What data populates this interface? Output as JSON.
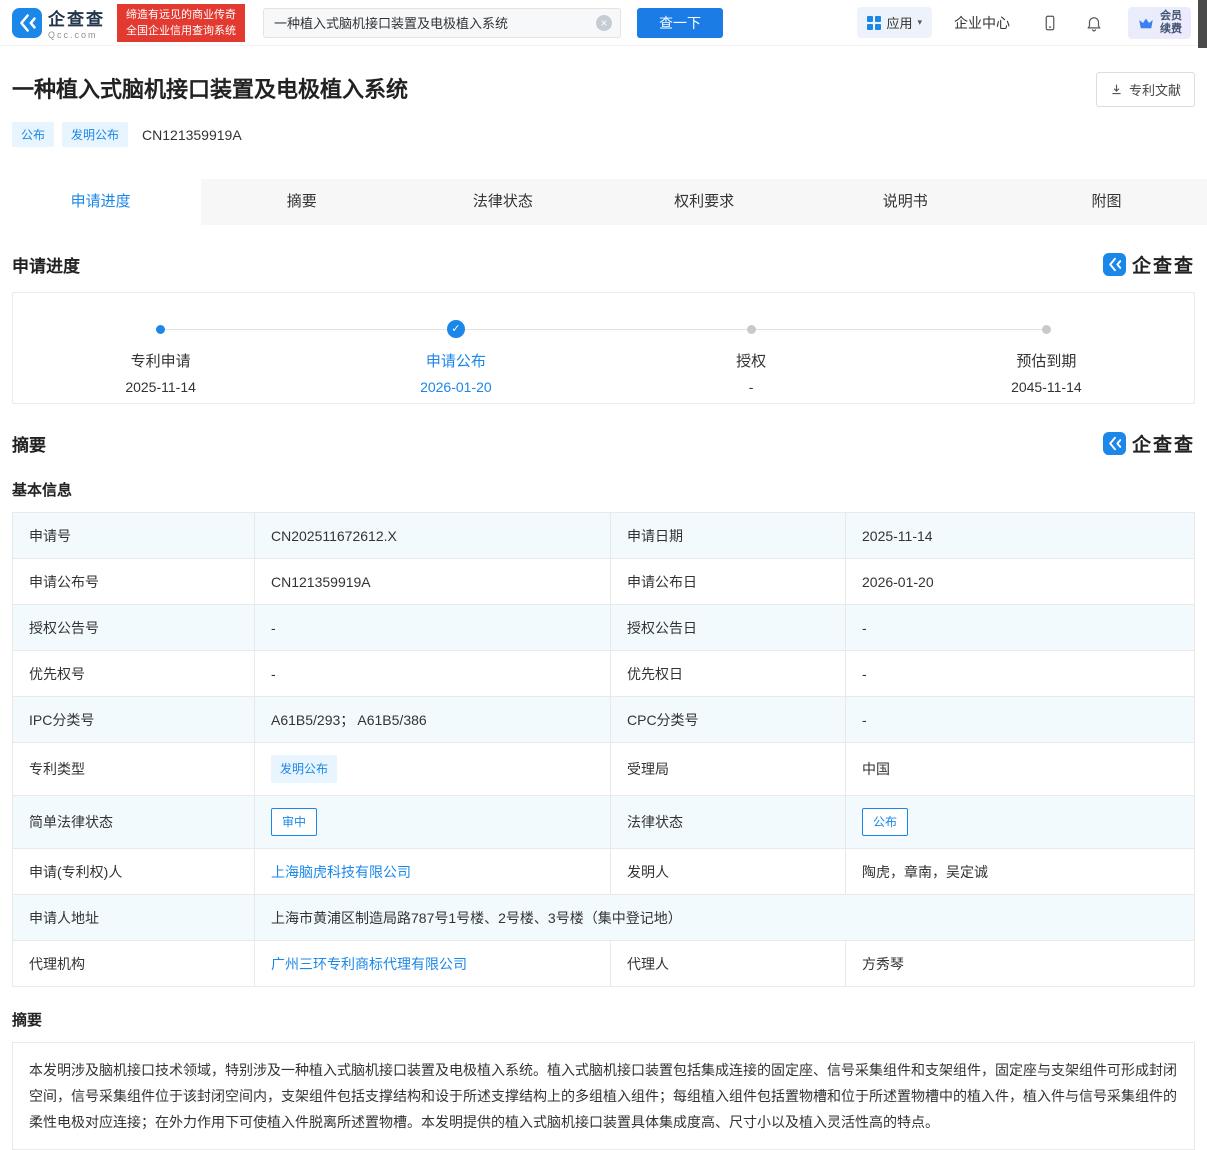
{
  "colors": {
    "brand_blue": "#1b87e8",
    "banner_red": "#e23a30",
    "row_alt": "#f3fafe",
    "tag_bg": "#e8f4fe"
  },
  "icons": {
    "check": "✓",
    "close": "×",
    "caret": "▾"
  },
  "watermark": "企查查",
  "header": {
    "logo": {
      "brand": "企查查",
      "domain": "Qcc.com"
    },
    "slogan": {
      "line1": "缔造有远见的商业传奇",
      "line2": "全国企业信用查询系统"
    },
    "search": {
      "value": "一种植入式脑机接口装置及电极植入系统",
      "button_label": "查一下"
    },
    "nav": {
      "apps_label": "应用",
      "enterprise_center": "企业中心",
      "vip_line1": "会员",
      "vip_line2": "续费"
    }
  },
  "patent": {
    "title": "一种植入式脑机接口装置及电极植入系统",
    "tag_publish": "公布",
    "tag_type": "发明公布",
    "number": "CN121359919A",
    "doc_button_label": "专利文献"
  },
  "tabs": [
    {
      "label": "申请进度"
    },
    {
      "label": "摘要"
    },
    {
      "label": "法律状态"
    },
    {
      "label": "权利要求"
    },
    {
      "label": "说明书"
    },
    {
      "label": "附图"
    }
  ],
  "progress": {
    "section_title": "申请进度",
    "milestones": [
      {
        "label": "专利申请",
        "date": "2025-11-14"
      },
      {
        "label": "申请公布",
        "date": "2026-01-20"
      },
      {
        "label": "授权",
        "date": "-"
      },
      {
        "label": "预估到期",
        "date": "2045-11-14"
      }
    ]
  },
  "summary": {
    "section_title": "摘要",
    "basic_info_title": "基本信息",
    "rows": [
      [
        {
          "label": "申请号",
          "value": "CN202511672612.X"
        },
        {
          "label": "申请日期",
          "value": "2025-11-14"
        }
      ],
      [
        {
          "label": "申请公布号",
          "value": "CN121359919A"
        },
        {
          "label": "申请公布日",
          "value": "2026-01-20"
        }
      ],
      [
        {
          "label": "授权公告号",
          "value": "-"
        },
        {
          "label": "授权公告日",
          "value": "-"
        }
      ],
      [
        {
          "label": "优先权号",
          "value": "-"
        },
        {
          "label": "优先权日",
          "value": "-"
        }
      ],
      [
        {
          "label": "IPC分类号",
          "value": "A61B5/293； A61B5/386"
        },
        {
          "label": "CPC分类号",
          "value": "-"
        }
      ],
      [
        {
          "label": "专利类型",
          "value": "发明公布"
        },
        {
          "label": "受理局",
          "value": "中国"
        }
      ],
      [
        {
          "label": "简单法律状态",
          "value": "审中"
        },
        {
          "label": "法律状态",
          "value": "公布"
        }
      ],
      [
        {
          "label": "申请(专利权)人",
          "value": "上海脑虎科技有限公司"
        },
        {
          "label": "发明人",
          "value": "陶虎，章南，吴定诚"
        }
      ],
      [
        {
          "label": "申请人地址",
          "value": "上海市黄浦区制造局路787号1号楼、2号楼、3号楼（集中登记地）"
        }
      ],
      [
        {
          "label": "代理机构",
          "value": "广州三环专利商标代理有限公司"
        },
        {
          "label": "代理人",
          "value": "方秀琴"
        }
      ]
    ],
    "abstract_title": "摘要",
    "abstract_text": "本发明涉及脑机接口技术领域，特别涉及一种植入式脑机接口装置及电极植入系统。植入式脑机接口装置包括集成连接的固定座、信号采集组件和支架组件，固定座与支架组件可形成封闭空间，信号采集组件位于该封闭空间内，支架组件包括支撑结构和设于所述支撑结构上的多组植入组件；每组植入组件包括置物槽和位于所述置物槽中的植入件，植入件与信号采集组件的柔性电极对应连接；在外力作用下可使植入件脱离所述置物槽。本发明提供的植入式脑机接口装置具体集成度高、尺寸小以及植入灵活性高的特点。"
  }
}
